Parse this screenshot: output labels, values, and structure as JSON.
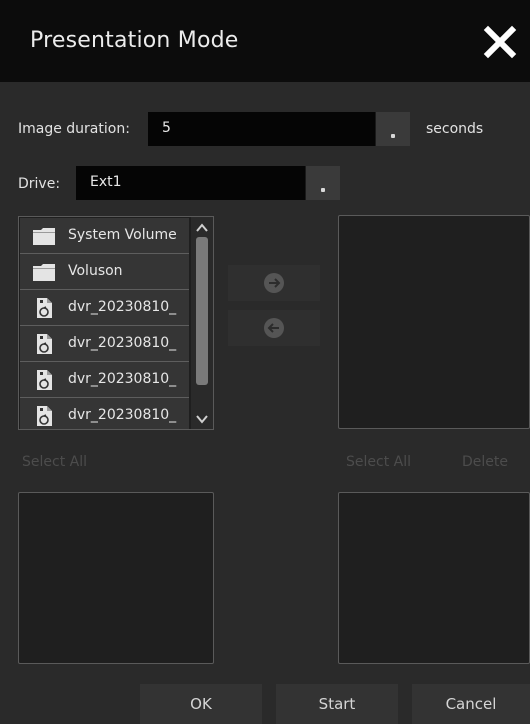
{
  "dialog": {
    "title": "Presentation Mode",
    "close_icon": "close-x-icon"
  },
  "image_duration": {
    "label": "Image duration:",
    "value": "5",
    "unit": "seconds"
  },
  "drive": {
    "label": "Drive:",
    "value": "Ext1"
  },
  "source_list": {
    "items": [
      {
        "name": "System Volume",
        "icon": "folder-icon"
      },
      {
        "name": "Voluson",
        "icon": "folder-icon"
      },
      {
        "name": "dvr_20230810_",
        "icon": "video-file-icon"
      },
      {
        "name": "dvr_20230810_",
        "icon": "video-file-icon"
      },
      {
        "name": "dvr_20230810_",
        "icon": "video-file-icon"
      },
      {
        "name": "dvr_20230810_",
        "icon": "video-file-icon"
      }
    ],
    "select_all_label": "Select All"
  },
  "transfer": {
    "add_icon": "arrow-right-icon",
    "remove_icon": "arrow-left-icon"
  },
  "playlist": {
    "select_all_label": "Select All",
    "delete_label": "Delete"
  },
  "footer": {
    "ok_label": "OK",
    "start_label": "Start",
    "cancel_label": "Cancel"
  },
  "colors": {
    "title_bar": "#0c0c0c",
    "background": "#2a2a2a",
    "panel": "#1f1f1f",
    "list_item": "#353535",
    "disabled_text": "#4c4c4c"
  }
}
